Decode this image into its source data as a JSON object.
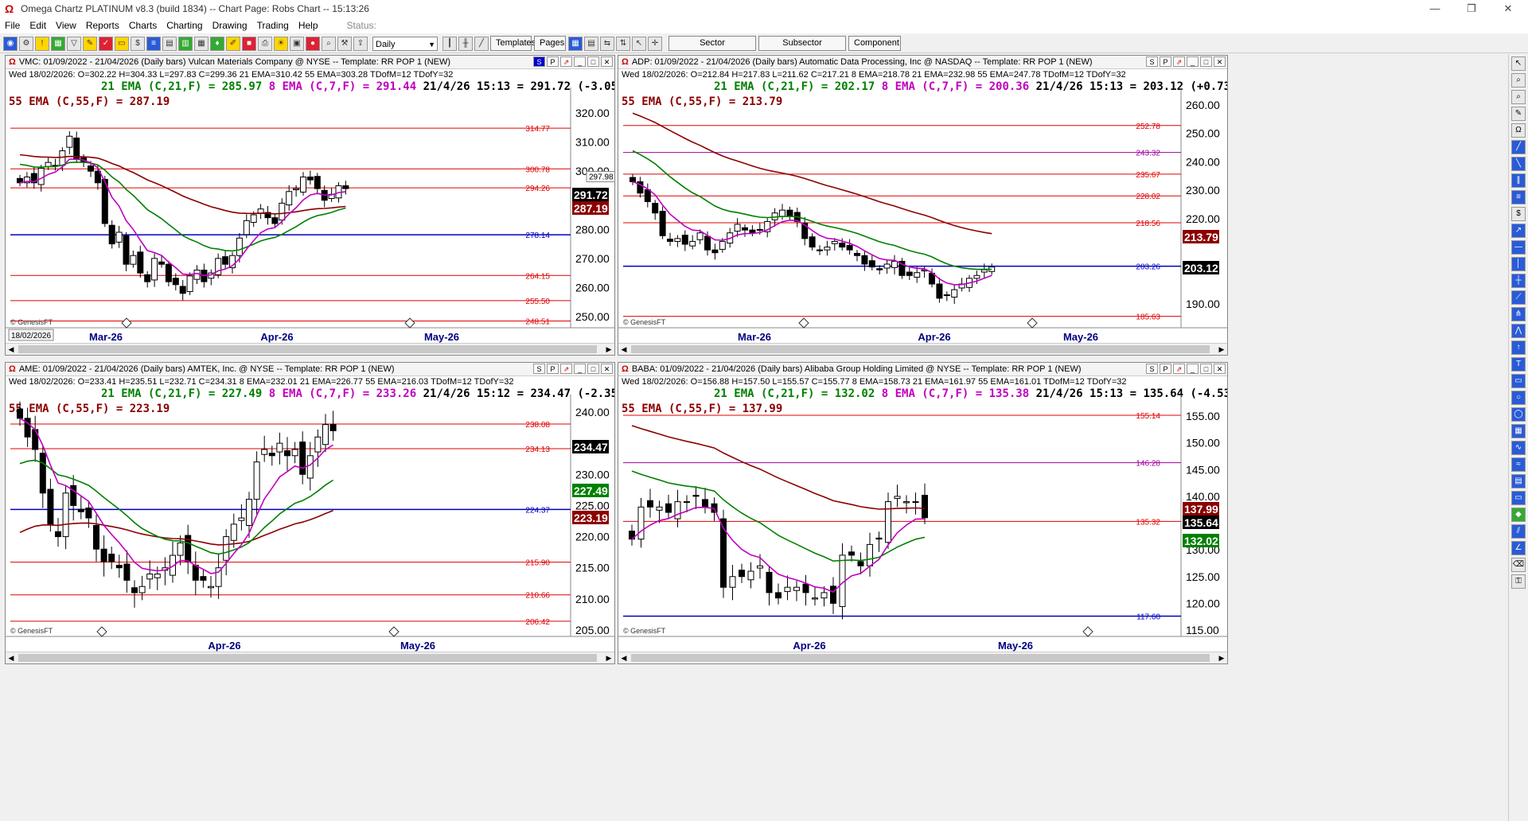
{
  "app": {
    "title": "Omega Chartz PLATINUM v8.3 (build 1834)  --  Chart Page: Robs Chart  --  15:13:26",
    "menu": [
      "File",
      "Edit",
      "View",
      "Reports",
      "Charts",
      "Charting",
      "Drawing",
      "Trading",
      "Help"
    ],
    "status_label": "Status:",
    "period": "Daily",
    "buttons": [
      "Templates",
      "Pages",
      "Sector",
      "Subsector",
      "Component"
    ],
    "window_controls": [
      "—",
      "❐",
      "✕"
    ]
  },
  "colors": {
    "ema21": "#008000",
    "ema8": "#c000c0",
    "ema55": "#8b0000",
    "hline_red": "#e00000",
    "hline_blue": "#0000c0",
    "hline_purple": "#a000a0",
    "price_label_bg": "#000000",
    "date_axis": "#000080"
  },
  "charts": [
    {
      "id": "vmc",
      "header": "VMC: 01/09/2022 - 21/04/2026  (Daily bars)  Vulcan Materials Company @ NYSE  --  Template: RR POP 1 (NEW)",
      "ohlc": "Wed  18/02/2026:  O=302.22  H=304.33  L=297.83  C=299.36  21 EMA=310.42  55 EMA=303.28  TDofM=12  TDofY=32",
      "ema21": "21 EMA (C,21,F) = 285.97",
      "ema8": "8 EMA (C,7,F) = 291.44",
      "last": "21/4/26 15:13 = 291.72 (-3.05)",
      "ema55": "55 EMA (C,55,F) = 287.19",
      "panel_buttons": [
        "S",
        "P",
        "⇗"
      ],
      "yaxis": [
        "320.00",
        "310.00",
        "300.00",
        "290",
        "280.00",
        "270.00",
        "260.00",
        "250.00"
      ],
      "hlines": [
        {
          "v": "314.77",
          "c": "red"
        },
        {
          "v": "300.78",
          "c": "red"
        },
        {
          "v": "294.26",
          "c": "red"
        },
        {
          "v": "278.14",
          "c": "blue"
        },
        {
          "v": "264.15",
          "c": "red"
        },
        {
          "v": "255.50",
          "c": "red"
        },
        {
          "v": "248.51",
          "c": "red"
        }
      ],
      "price_tags": [
        {
          "v": "291.72",
          "bg": "#000",
          "fg": "#fff"
        },
        {
          "v": "287.19",
          "bg": "#8b0000",
          "fg": "#fff"
        }
      ],
      "cursor_tag": "297.98",
      "months": [
        "Mar-26",
        "Apr-26",
        "May-26"
      ],
      "date_box": "18/02/2026",
      "credit": "© GenesisFT"
    },
    {
      "id": "adp",
      "header": "ADP: 01/09/2022 - 21/04/2026  (Daily bars)  Automatic Data Processing, Inc @ NASDAQ  --  Template: RR POP 1 (NEW)",
      "ohlc": "Wed  18/02/2026:  O=212.84  H=217.83  L=211.62  C=217.21  8 EMA=218.78  21 EMA=232.98  55 EMA=247.78  TDofM=12  TDofY=32",
      "ema21": "21 EMA (C,21,F) = 202.17",
      "ema8": "8 EMA (C,7,F) = 200.36",
      "last": "21/4/26 15:13 = 203.12 (+0.73)",
      "ema55": "55 EMA (C,55,F) = 213.79",
      "panel_buttons": [
        "S",
        "P",
        "⇗"
      ],
      "yaxis": [
        "260.00",
        "250.00",
        "240.00",
        "230.00",
        "220.00",
        "190.00"
      ],
      "hlines": [
        {
          "v": "252.78",
          "c": "red"
        },
        {
          "v": "243.32",
          "c": "purple"
        },
        {
          "v": "235.67",
          "c": "red"
        },
        {
          "v": "228.02",
          "c": "red"
        },
        {
          "v": "218.56",
          "c": "red"
        },
        {
          "v": "203.26",
          "c": "blue"
        },
        {
          "v": "185.63",
          "c": "red"
        }
      ],
      "price_tags": [
        {
          "v": "213.79",
          "bg": "#8b0000",
          "fg": "#fff"
        },
        {
          "v": "203.12",
          "bg": "#000",
          "fg": "#fff"
        }
      ],
      "months": [
        "Mar-26",
        "Apr-26",
        "May-26"
      ],
      "credit": "© GenesisFT"
    },
    {
      "id": "ame",
      "header": "AME: 01/09/2022 - 21/04/2026  (Daily bars)  AMTEK, Inc. @ NYSE  --  Template: RR POP 1 (NEW)",
      "ohlc": "Wed  18/02/2026:  O=233.41  H=235.51  L=232.71  C=234.31  8 EMA=232.01  21 EMA=226.77  55 EMA=216.03  TDofM=12  TDofY=32",
      "ema21": "21 EMA (C,21,F) = 227.49",
      "ema8": "8 EMA (C,7,F) = 233.26",
      "last": "21/4/26 15:12 = 234.47 (-2.35)",
      "ema55": "55 EMA (C,55,F) = 223.19",
      "panel_buttons": [
        "S",
        "P",
        "⇗"
      ],
      "yaxis": [
        "240.00",
        "230.00",
        "225.00",
        "220.00",
        "215.00",
        "210.00",
        "205.00"
      ],
      "hlines": [
        {
          "v": "238.08",
          "c": "red"
        },
        {
          "v": "234.13",
          "c": "red"
        },
        {
          "v": "224.37",
          "c": "blue"
        },
        {
          "v": "215.90",
          "c": "red"
        },
        {
          "v": "210.66",
          "c": "red"
        },
        {
          "v": "206.42",
          "c": "red"
        }
      ],
      "price_tags": [
        {
          "v": "234.47",
          "bg": "#000",
          "fg": "#fff"
        },
        {
          "v": "227.49",
          "bg": "#008000",
          "fg": "#fff"
        },
        {
          "v": "223.19",
          "bg": "#8b0000",
          "fg": "#fff"
        }
      ],
      "months": [
        "Apr-26",
        "May-26"
      ],
      "credit": "© GenesisFT"
    },
    {
      "id": "baba",
      "header": "BABA: 01/09/2022 - 21/04/2026  (Daily bars)  Alibaba Group Holding Limited @ NYSE  --  Template: RR POP 1 (NEW)",
      "ohlc": "Wed  18/02/2026:  O=156.88  H=157.50  L=155.57  C=155.77  8 EMA=158.73  21 EMA=161.97  55 EMA=161.01  TDofM=12  TDofY=32",
      "ema21": "21 EMA (C,21,F) = 132.02",
      "ema8": "8 EMA (C,7,F) = 135.38",
      "last": "21/4/26 15:13 = 135.64 (-4.53)",
      "ema55": "55 EMA (C,55,F) = 137.99",
      "panel_buttons": [
        "S",
        "P",
        "⇗"
      ],
      "yaxis": [
        "155.00",
        "150.00",
        "145.00",
        "140.00",
        "130.00",
        "125.00",
        "120.00",
        "115.00"
      ],
      "hlines": [
        {
          "v": "155.14",
          "c": "red"
        },
        {
          "v": "146.28",
          "c": "purple"
        },
        {
          "v": "135.32",
          "c": "red"
        },
        {
          "v": "117.60",
          "c": "blue"
        }
      ],
      "price_tags": [
        {
          "v": "137.99",
          "bg": "#8b0000",
          "fg": "#fff"
        },
        {
          "v": "135.64",
          "bg": "#000",
          "fg": "#fff"
        },
        {
          "v": "132.02",
          "bg": "#008000",
          "fg": "#fff"
        }
      ],
      "months": [
        "Apr-26",
        "May-26"
      ],
      "credit": "© GenesisFT"
    }
  ]
}
